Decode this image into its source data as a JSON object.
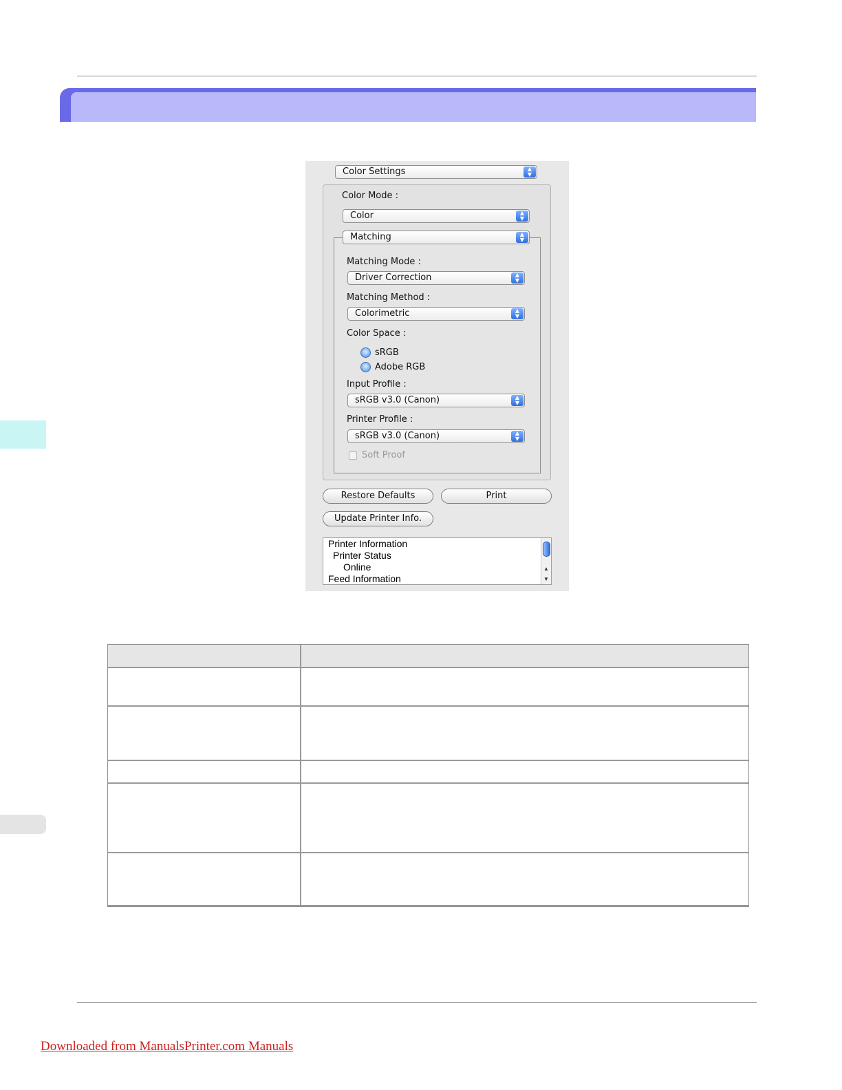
{
  "dialog": {
    "panel_select": "Color Settings",
    "color_mode_label": "Color Mode :",
    "color_mode_value": "Color",
    "sub_panel_select": "Matching",
    "matching_mode_label": "Matching Mode :",
    "matching_mode_value": "Driver Correction",
    "matching_method_label": "Matching Method :",
    "matching_method_value": "Colorimetric",
    "color_space_label": "Color Space :",
    "color_space_options": [
      "sRGB",
      "Adobe RGB"
    ],
    "input_profile_label": "Input Profile :",
    "input_profile_value": "sRGB v3.0 (Canon)",
    "printer_profile_label": "Printer Profile :",
    "printer_profile_value": "sRGB v3.0 (Canon)",
    "soft_proof_label": "Soft Proof",
    "restore_defaults_label": "Restore Defaults",
    "print_label": "Print",
    "update_printer_info_label": "Update Printer Info.",
    "info_list": [
      "Printer Information",
      "Printer Status",
      "Online",
      "Feed Information"
    ]
  },
  "footer": {
    "link_text": "Downloaded from ManualsPrinter.com Manuals"
  },
  "colors": {
    "header_band_dark": "#6a6ae8",
    "header_band_light": "#b8b8fb",
    "side_tab": "#c9f5f5",
    "footer_link": "#cc2222"
  }
}
